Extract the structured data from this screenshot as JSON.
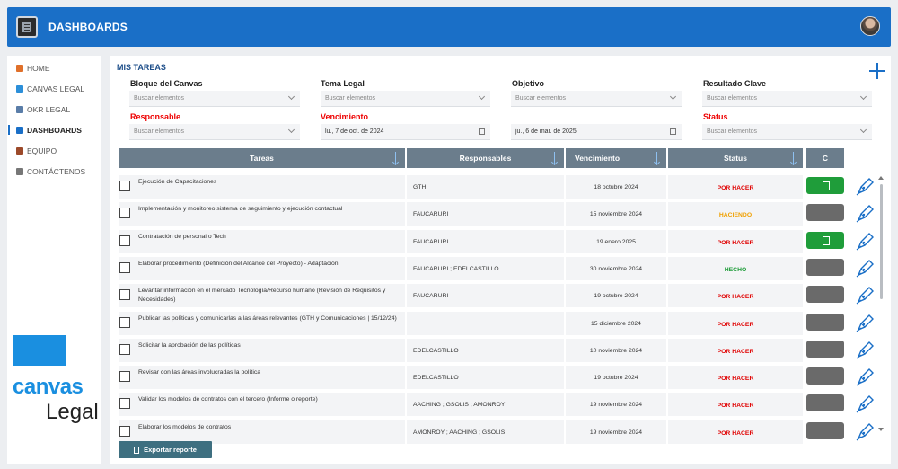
{
  "header": {
    "title": "DASHBOARDS"
  },
  "sidebar": {
    "items": [
      {
        "label": "HOME",
        "icon": "home-icon",
        "color": "#e0702a"
      },
      {
        "label": "CANVAS LEGAL",
        "icon": "canvas-icon",
        "color": "#2c8fd9"
      },
      {
        "label": "OKR LEGAL",
        "icon": "okr-icon",
        "color": "#5a7da8"
      },
      {
        "label": "DASHBOARDS",
        "icon": "dashboard-icon",
        "color": "#1a6fc7",
        "active": true
      },
      {
        "label": "EQUIPO",
        "icon": "team-icon",
        "color": "#9c4a2a"
      },
      {
        "label": "CONTÁCTENOS",
        "icon": "headset-icon",
        "color": "#777777"
      }
    ],
    "brand_top": "canvas",
    "brand_bottom": "Legal"
  },
  "main": {
    "section_title": "MIS TAREAS",
    "filters": {
      "bloque": {
        "label": "Bloque del Canvas",
        "placeholder": "Buscar elementos"
      },
      "tema": {
        "label": "Tema Legal",
        "placeholder": "Buscar elementos"
      },
      "objetivo": {
        "label": "Objetivo",
        "placeholder": "Buscar elementos"
      },
      "resultado": {
        "label": "Resultado Clave",
        "placeholder": "Buscar elementos"
      },
      "responsable": {
        "label": "Responsable",
        "placeholder": "Buscar elementos"
      },
      "vencimiento": {
        "label": "Vencimiento",
        "from": "lu., 7 de oct. de 2024",
        "to": "ju., 6 de mar. de 2025"
      },
      "status": {
        "label": "Status",
        "placeholder": "Buscar elementos"
      }
    },
    "table": {
      "headers": {
        "tareas": "Tareas",
        "responsables": "Responsables",
        "vencimiento": "Vencimiento",
        "status": "Status",
        "c": "C"
      },
      "rows": [
        {
          "task": "Ejecución de Capacitaciones",
          "resp": "GTH",
          "date": "18 octubre 2024",
          "status": "POR HACER",
          "status_color": "#e00000",
          "btn": "green"
        },
        {
          "task": "Implementación y monitoreo sistema de seguimiento y ejecución contactual",
          "resp": "FAUCARURI",
          "date": "15 noviembre 2024",
          "status": "HACIENDO",
          "status_color": "#f0a000",
          "btn": "gray"
        },
        {
          "task": "Contratación de personal o Tech",
          "resp": "FAUCARURI",
          "date": "19 enero 2025",
          "status": "POR HACER",
          "status_color": "#e00000",
          "btn": "green"
        },
        {
          "task": "Elaborar procedimiento (Definición del Alcance del Proyecto) - Adaptación",
          "resp": "FAUCARURI ; EDELCASTILLO",
          "date": "30 noviembre 2024",
          "status": "HECHO",
          "status_color": "#1f9d3a",
          "btn": "gray"
        },
        {
          "task": "Levantar información en el mercado Tecnología/Recurso humano (Revisión de Requisitos y Necesidades)",
          "resp": "FAUCARURI",
          "date": "19 octubre 2024",
          "status": "POR HACER",
          "status_color": "#e00000",
          "btn": "gray"
        },
        {
          "task": "Publicar las políticas y comunicarlas a las áreas relevantes (GTH y Comunicaciones | 15/12/24)",
          "resp": "",
          "date": "15 diciembre 2024",
          "status": "POR HACER",
          "status_color": "#e00000",
          "btn": "gray"
        },
        {
          "task": "Solicitar la aprobación de las políticas",
          "resp": "EDELCASTILLO",
          "date": "10 noviembre 2024",
          "status": "POR HACER",
          "status_color": "#e00000",
          "btn": "gray"
        },
        {
          "task": "Revisar con las áreas involucradas la política",
          "resp": "EDELCASTILLO",
          "date": "19 octubre 2024",
          "status": "POR HACER",
          "status_color": "#e00000",
          "btn": "gray"
        },
        {
          "task": "Validar los modelos de contratos con el tercero (Informe o reporte)",
          "resp": "AACHING ; GSOLIS ; AMONROY",
          "date": "19 noviembre 2024",
          "status": "POR HACER",
          "status_color": "#e00000",
          "btn": "gray"
        },
        {
          "task": "Elaborar los modelos de contratos",
          "resp": "AMONROY ; AACHING ; GSOLIS",
          "date": "19 noviembre 2024",
          "status": "POR HACER",
          "status_color": "#e00000",
          "btn": "gray"
        }
      ]
    },
    "export_label": "Exportar reporte"
  }
}
